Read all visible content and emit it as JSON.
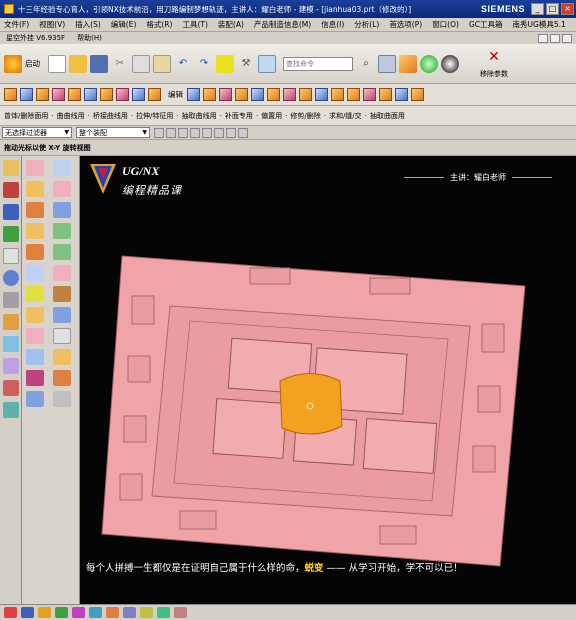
{
  "window": {
    "title": "十三年经验专心育人，引领NX技术前沿，用刀路编制梦想轨迹，主讲人：耀白老师 - 建模 - [jianhua03.prt（修改的）]",
    "brand": "SIEMENS",
    "controls": [
      "_",
      "□",
      "×"
    ]
  },
  "menu": {
    "items": [
      "文件(F)",
      "视图(V)",
      "插入(S)",
      "编辑(E)",
      "格式(R)",
      "工具(T)",
      "装配(A)",
      "产品制造信息(M)",
      "信息(I)",
      "分析(L)",
      "首选项(P)",
      "窗口(O)",
      "GC工具箱",
      "帮助(H)"
    ],
    "extra": "南秀UG模具5.1"
  },
  "version_row": {
    "items": [
      "星空外挂 V6.935F",
      "帮助(H)"
    ]
  },
  "toolbar1": {
    "start_label": "启动",
    "search_placeholder": "查找命令",
    "move_parameters_label": "移除参数"
  },
  "toolbar2": {
    "edit_label": "编辑"
  },
  "toolbar3": {
    "items": [
      "曾体/删除面用",
      "曲曲线用",
      "桥接曲线用",
      "拉伸/特征用",
      "抽取曲线用",
      "补面专用",
      "偏置用",
      "修剪/删除",
      "求和/缝/交",
      "抽取曲面用"
    ]
  },
  "filterbar": {
    "selection_filter": "无选择过滤器",
    "scope": "整个装配"
  },
  "cue": {
    "text": "拖动光标以使 X-Y 旋转视图"
  },
  "overlay": {
    "logo_line1": "UG/NX",
    "logo_line2": "编程精品课",
    "lecturer": "主讲：耀白老师",
    "subtitle_pre": "每个人拼搏一生都仅是在证明自己属于什么样的命，",
    "subtitle_highlight": "蜕变",
    "subtitle_post": " —— 从学习开始，学不可以已！"
  },
  "colors": {
    "model_pink": "#f0a4a8",
    "highlight_orange": "#f4a020",
    "title_blue": "#1a3f9a",
    "subtitle_highlight": "#ffd020"
  }
}
